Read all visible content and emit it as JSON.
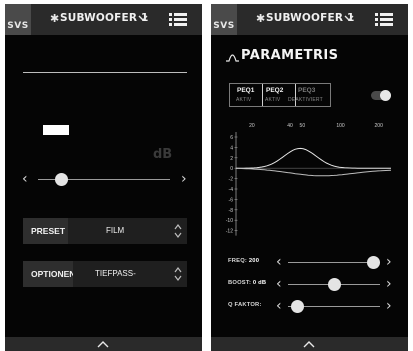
{
  "left_screen": {
    "topbar": {
      "logo": "SVS",
      "device_name": "SUBWOOFER 1"
    },
    "db_unit": "dB",
    "volume_slider": {
      "value_fraction": 0.18
    },
    "preset": {
      "label": "PRESET",
      "value": "FILM"
    },
    "options": {
      "label": "OPTIONEN",
      "value": "TIEFPASS-"
    }
  },
  "right_screen": {
    "topbar": {
      "logo": "SVS",
      "device_name": "SUBWOOFER 1"
    },
    "title": "PARAMETRIS",
    "peq_tabs": [
      {
        "name": "PEQ1",
        "status": "AKTIV",
        "state": "active"
      },
      {
        "name": "PEQ2",
        "status": "AKTIV",
        "state": "selected"
      },
      {
        "name": "PEQ3",
        "status": "DEAKTIVIERT",
        "state": "inactive"
      }
    ],
    "toggle_on": true,
    "graph": {
      "x_ticks": [
        "20",
        "40",
        "50",
        "100",
        "200"
      ],
      "y_ticks": [
        "6",
        "4",
        "2",
        "0",
        "-2",
        "-4",
        "-6",
        "-8",
        "-10",
        "-12"
      ]
    },
    "freq": {
      "label": "FREQ:",
      "value": "200",
      "slider_fraction": 0.93
    },
    "boost": {
      "label": "BOOST:",
      "value": "0 dB",
      "slider_fraction": 0.5
    },
    "q_factor": {
      "label": "Q FAKTOR:",
      "value": "",
      "slider_fraction": 0.1
    }
  },
  "colors": {
    "background": "#050505",
    "bar": "#2a2a2a",
    "text": "#f2f2f2"
  }
}
